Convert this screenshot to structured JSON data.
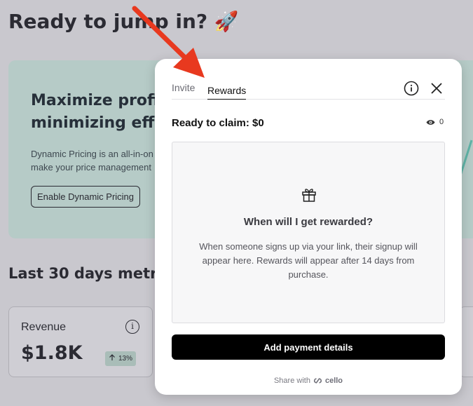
{
  "background": {
    "title": "Ready to jump in? 🚀",
    "banner": {
      "title_line1": "Maximize profit w",
      "title_line2": "minimizing effor",
      "desc_line1": "Dynamic Pricing is an all-in-on",
      "desc_line2": "make your price management",
      "enable_button": "Enable Dynamic Pricing"
    },
    "metrics_title": "Last 30 days metrics",
    "revenue_card": {
      "label": "Revenue",
      "value": "$1.8K",
      "change": "13%",
      "info_icon": "info-icon"
    }
  },
  "popup": {
    "tabs": [
      {
        "label": "Invite",
        "active": false
      },
      {
        "label": "Rewards",
        "active": true
      }
    ],
    "claim_label": "Ready to claim: $0",
    "views_count": "0",
    "reward_box": {
      "title": "When will I get rewarded?",
      "description": "When someone signs up via your link, their signup will appear here. Rewards will appear after 14 days from purchase."
    },
    "primary_button": "Add payment details",
    "share_prefix": "Share with",
    "share_brand": "cello"
  },
  "colors": {
    "arrow": "#e8391f",
    "overlay": "#c9c8ce",
    "banner": "#b6cbc7",
    "primary_button": "#000000"
  }
}
